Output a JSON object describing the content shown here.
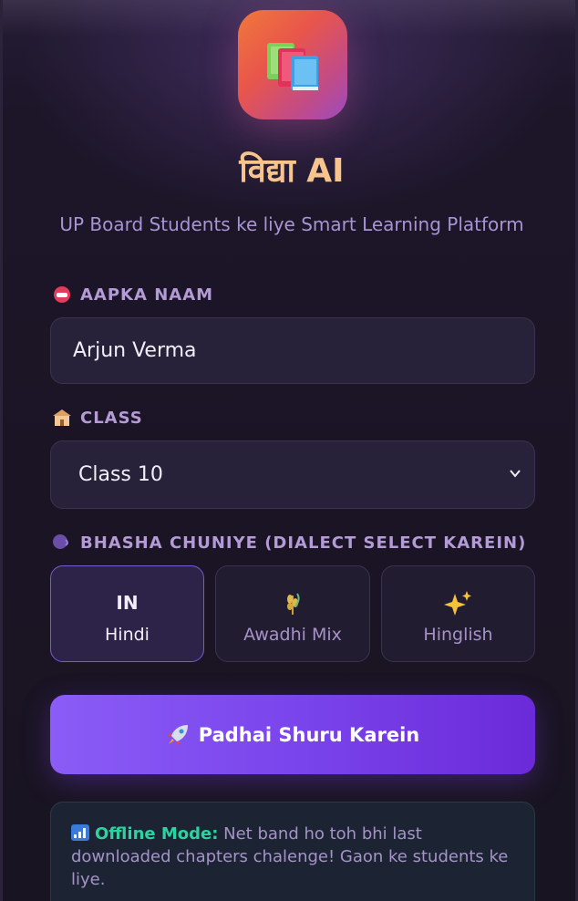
{
  "app": {
    "title": "विद्या AI",
    "subtitle": "UP Board Students ke liye Smart Learning Platform",
    "logo_icon": "books-icon"
  },
  "form": {
    "name_label": "AAPKA NAAM",
    "name_value": "Arjun Verma",
    "class_label": "CLASS",
    "class_value": "Class 10",
    "dialect_label": "BHASHA CHUNIYE (DIALECT SELECT KAREIN)"
  },
  "dialects": [
    {
      "icon_text": "IN",
      "icon": "india-flag-icon",
      "label": "Hindi",
      "selected": true
    },
    {
      "icon_text": "",
      "icon": "wheat-icon",
      "label": "Awadhi Mix",
      "selected": false
    },
    {
      "icon_text": "",
      "icon": "sparkles-icon",
      "label": "Hinglish",
      "selected": false
    }
  ],
  "cta": {
    "label": "Padhai Shuru Karein",
    "icon": "rocket-icon"
  },
  "offline": {
    "title": "Offline Mode:",
    "text": " Net band ho toh bhi last downloaded chapters chalenge! Gaon ke students ke liye."
  },
  "colors": {
    "accent": "#8b5cf6",
    "title": "#f6c48c",
    "offline_highlight": "#2bd3a0"
  }
}
